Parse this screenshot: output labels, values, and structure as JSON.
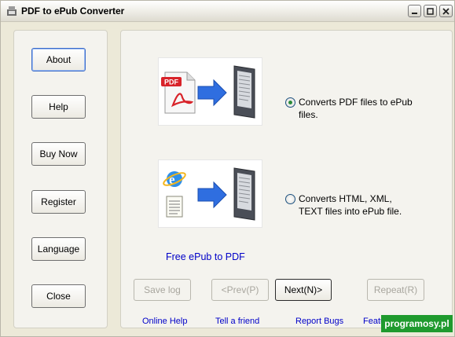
{
  "window": {
    "title": "PDF to ePub Converter"
  },
  "sidebar": {
    "buttons": [
      {
        "label": "About"
      },
      {
        "label": "Help"
      },
      {
        "label": "Buy Now"
      },
      {
        "label": "Register"
      },
      {
        "label": "Language"
      },
      {
        "label": "Close"
      }
    ]
  },
  "options": [
    {
      "line1": "Converts PDF files to ePub",
      "line2": "files.",
      "selected": true
    },
    {
      "line1": "Converts HTML, XML,",
      "line2": "TEXT files into ePub file.",
      "selected": false
    }
  ],
  "main": {
    "promo_link": "Free ePub to PDF"
  },
  "nav_buttons": {
    "save_log": "Save log",
    "prev": "<Prev(P)",
    "next": "Next(N)>",
    "repeat": "Repeat(R)"
  },
  "footer_links": {
    "online_help": "Online Help",
    "tell_friend": "Tell a friend",
    "report_bugs": "Report Bugs",
    "feature": "Featu"
  },
  "watermark": "programosy.pl",
  "colors": {
    "link": "#0000c8",
    "arrow_blue": "#2f6ee0",
    "radio_dot": "#2b8b3a",
    "pdf_red": "#d8232a",
    "watermark_bg": "#1f9a2e"
  }
}
